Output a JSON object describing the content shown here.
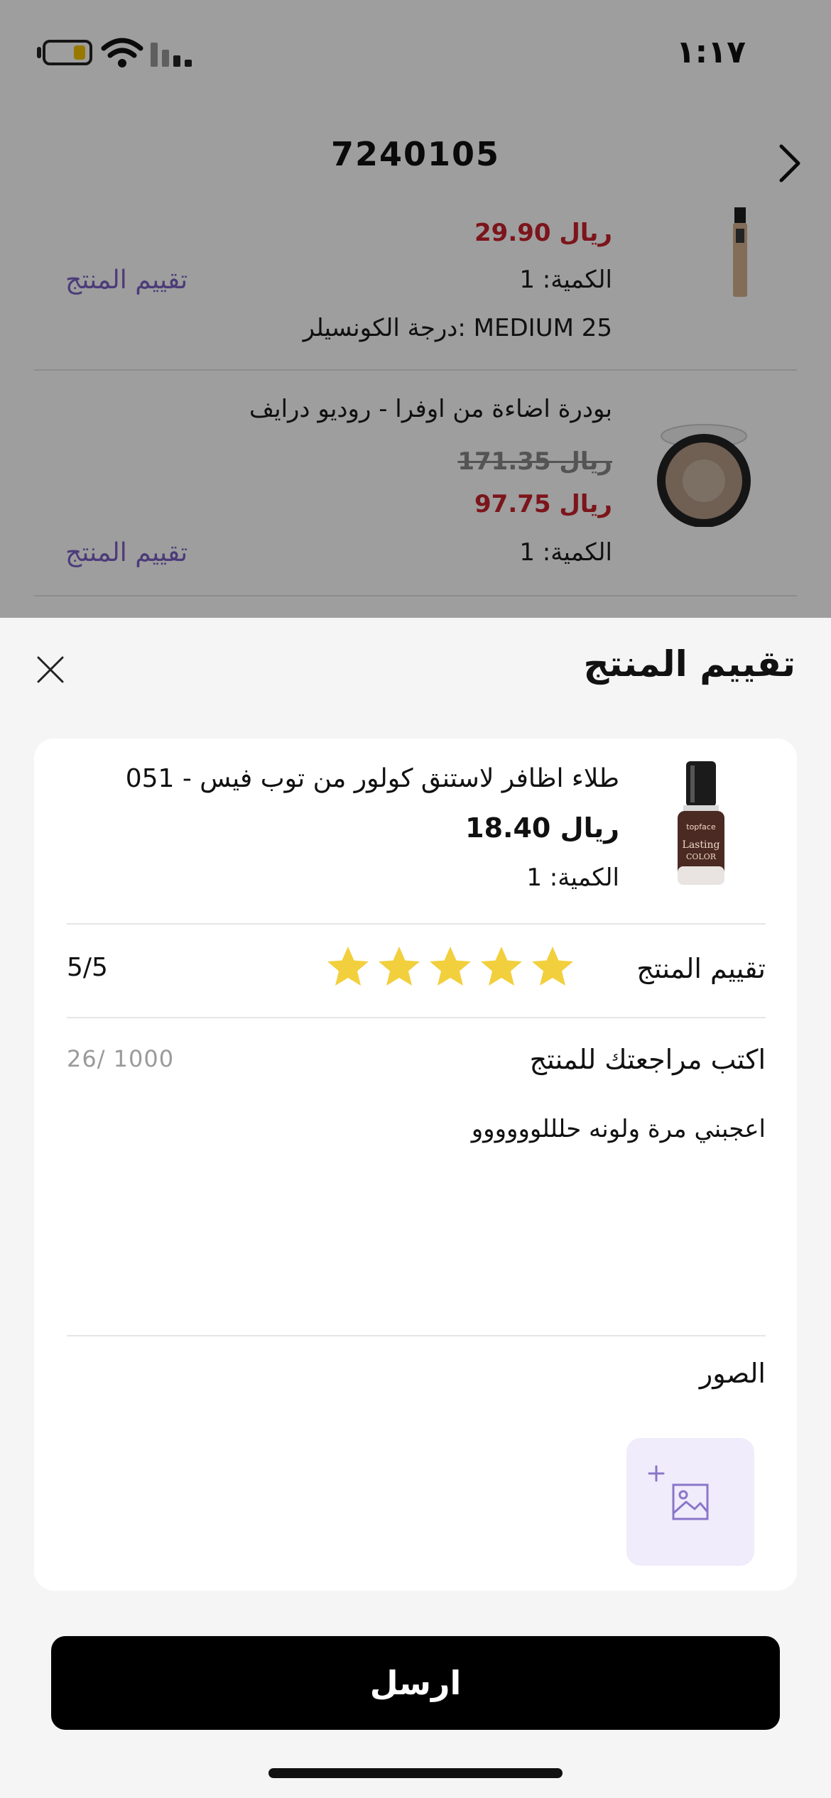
{
  "status_bar": {
    "time": "١:١٧",
    "battery_level": 0.3,
    "battery_color": "#f5c400"
  },
  "order": {
    "number": "7240105",
    "back_icon": "chevron-right-icon"
  },
  "background_items": [
    {
      "price": "29.90 ريال",
      "quantity": "الكمية: 1",
      "variant": "درجة الكونسيلر: MEDIUM 25",
      "rate_link": "تقييم المنتج"
    },
    {
      "name": "بودرة اضاءة من اوفرا - روديو درايف",
      "old_price": "171.35 ريال",
      "price": "97.75 ريال",
      "quantity": "الكمية: 1",
      "rate_link": "تقييم المنتج"
    }
  ],
  "sheet": {
    "title": "تقييم المنتج",
    "close_icon": "close-icon",
    "product": {
      "name": "طلاء اظافر لاستنق كولور من توب فيس - 051",
      "price": "18.40 ريال",
      "quantity": "الكمية: 1",
      "image_icon": "nail-polish-bottle"
    },
    "rating": {
      "label": "تقييم المنتج",
      "value": 5,
      "max": 5,
      "score_text": "5/5",
      "star_color": "#f2cf3d"
    },
    "review": {
      "label": "اكتب مراجعتك للمنتج",
      "counter": "26/ 1000",
      "text": "اعجبني مرة ولونه حلللوووووو"
    },
    "photos": {
      "label": "الصور",
      "add_icon": "add-image-icon",
      "accent": "#8a76c9"
    },
    "submit_label": "ارسل"
  },
  "colors": {
    "accent_purple": "#7b5fc4",
    "price_red": "#c8232c",
    "button_black": "#000000"
  }
}
